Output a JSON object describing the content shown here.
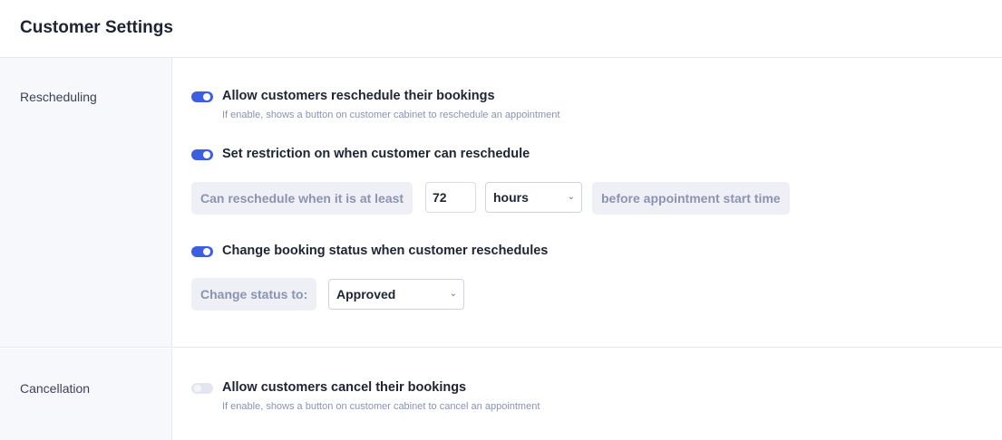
{
  "header": {
    "title": "Customer Settings"
  },
  "rescheduling": {
    "label": "Rescheduling",
    "allow": {
      "enabled": true,
      "label": "Allow customers reschedule their bookings",
      "description": "If enable, shows a button on customer cabinet to reschedule an appointment"
    },
    "restriction": {
      "enabled": true,
      "label": "Set restriction on when customer can reschedule",
      "prefix": "Can reschedule when it is at least",
      "amount": "72",
      "unit": "hours",
      "suffix": "before appointment start time"
    },
    "status_change": {
      "enabled": true,
      "label": "Change booking status when customer reschedules",
      "prefix": "Change status to:",
      "status": "Approved"
    }
  },
  "cancellation": {
    "label": "Cancellation",
    "allow": {
      "enabled": false,
      "label": "Allow customers cancel their bookings",
      "description": "If enable, shows a button on customer cabinet to cancel an appointment"
    }
  },
  "colors": {
    "accent": "#3b5fe0",
    "toggle_off": "#e3e6f0",
    "sidebar_bg": "#f7f8fc"
  },
  "icons": {
    "select_arrow": "chevron-down-icon"
  }
}
